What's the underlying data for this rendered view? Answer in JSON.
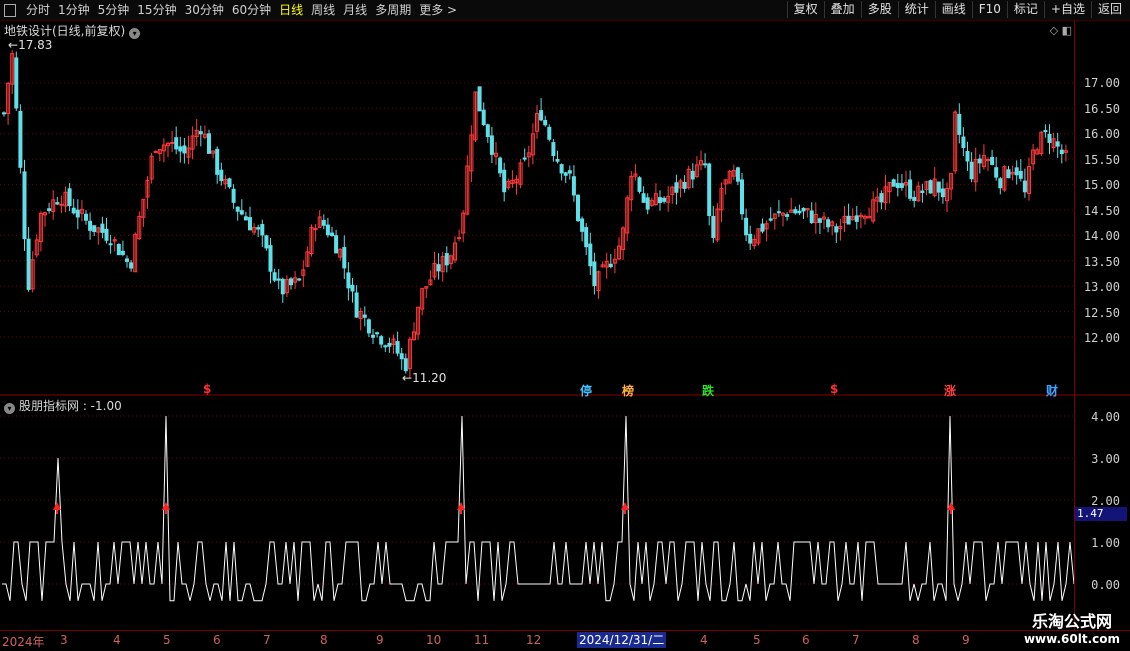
{
  "toolbar": {
    "tabs": [
      "分时",
      "1分钟",
      "5分钟",
      "15分钟",
      "30分钟",
      "60分钟",
      "日线",
      "周线",
      "月线",
      "多周期",
      "更多 >"
    ],
    "active_tab": "日线",
    "right_buttons": [
      "复权",
      "叠加",
      "多股",
      "统计",
      "画线",
      "F10",
      "标记",
      "+自选",
      "返回"
    ]
  },
  "main_panel": {
    "title": "地铁设计(日线,前复权)",
    "high_label": "17.83",
    "low_label": "11.20",
    "price_axis": [
      "17.00",
      "16.50",
      "16.00",
      "15.50",
      "15.00",
      "14.50",
      "14.00",
      "13.50",
      "13.00",
      "12.50",
      "12.00"
    ],
    "signals": [
      {
        "text": "$",
        "color": "#ff3030",
        "cls": "s1"
      },
      {
        "text": "停",
        "color": "#40c0ff",
        "cls": "s2"
      },
      {
        "text": "榜",
        "color": "#ffb040",
        "cls": "s3"
      },
      {
        "text": "跌",
        "color": "#30e030",
        "cls": "s4"
      },
      {
        "text": "$",
        "color": "#ff3030",
        "cls": "s5"
      },
      {
        "text": "涨",
        "color": "#ff4040",
        "cls": "s6"
      },
      {
        "text": "财",
        "color": "#40a0ff",
        "cls": "s7"
      }
    ]
  },
  "indicator_panel": {
    "title": "股朋指标网 : -1.00",
    "axis": [
      "4.00",
      "3.00",
      "2.00",
      "1.00",
      "0.00"
    ],
    "current_value": "1.47"
  },
  "date_axis": {
    "labels": [
      "2024年",
      "3",
      "4",
      "5",
      "6",
      "7",
      "8",
      "9",
      "10",
      "11",
      "12",
      "4",
      "5",
      "6",
      "7",
      "8",
      "9"
    ],
    "cursor": "2024/12/31/二"
  },
  "watermark": {
    "title": "乐淘公式网",
    "url": "www.60lt.com"
  },
  "colors": {
    "up": "#ff3a3a",
    "down": "#5fe0e8",
    "grid": "#7a0000",
    "line": "#ffffff",
    "accent": "#ffff00"
  }
}
